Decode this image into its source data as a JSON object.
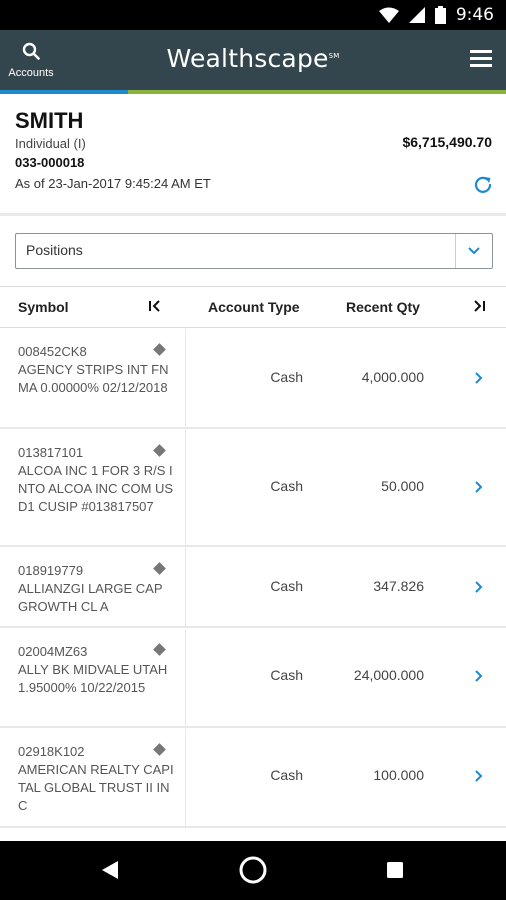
{
  "status": {
    "time": "9:46"
  },
  "header": {
    "search_label": "Accounts",
    "brand": "Wealthscape",
    "brand_mark": "SM"
  },
  "account": {
    "name": "SMITH",
    "type": "Individual (I)",
    "number": "033-000018",
    "as_of": "As of 23-Jan-2017 9:45:24 AM ET",
    "value": "$6,715,490.70"
  },
  "view_selector": {
    "value": "Positions"
  },
  "table": {
    "columns": {
      "symbol": "Symbol",
      "account_type": "Account Type",
      "recent_qty": "Recent Qty"
    },
    "rows": [
      {
        "symbol": "008452CK8",
        "description": "AGENCY STRIPS INT FNMA 0.00000% 02/12/2018",
        "account_type": "Cash",
        "recent_qty": "4,000.000"
      },
      {
        "symbol": "013817101",
        "description": "ALCOA INC 1 FOR 3 R/S INTO ALCOA INC COM USD1 CUSIP #013817507",
        "account_type": "Cash",
        "recent_qty": "50.000"
      },
      {
        "symbol": "018919779",
        "description": "ALLIANZGI LARGE CAP GROWTH CL A",
        "account_type": "Cash",
        "recent_qty": "347.826"
      },
      {
        "symbol": "02004MZ63",
        "description": "ALLY BK MIDVALE UTAH 1.95000% 10/22/2015",
        "account_type": "Cash",
        "recent_qty": "24,000.000"
      },
      {
        "symbol": "02918K102",
        "description": "AMERICAN REALTY CAPITAL GLOBAL TRUST II INC",
        "account_type": "Cash",
        "recent_qty": "100.000"
      }
    ]
  },
  "colors": {
    "app_bar": "#33464d",
    "accent_blue": "#1d8ad0",
    "accent_green": "#8ab43f",
    "link": "#1d8ad0"
  }
}
